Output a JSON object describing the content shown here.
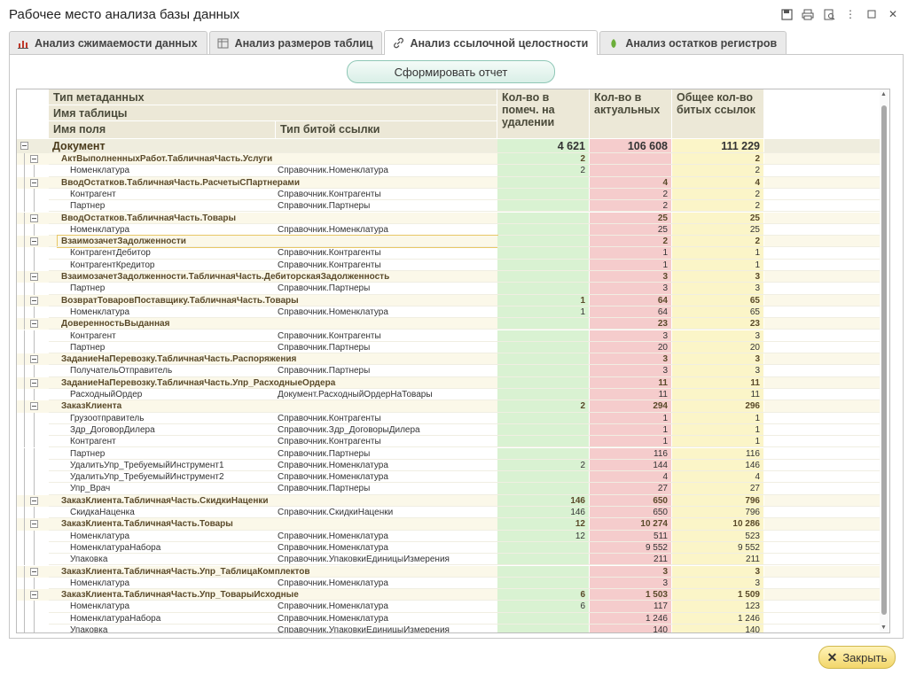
{
  "window": {
    "title": "Рабочее место анализа базы данных",
    "icons": [
      "save-icon",
      "print-icon",
      "preview-icon",
      "more-icon",
      "maximize-icon",
      "close-icon"
    ]
  },
  "tabs": [
    {
      "label": "Анализ сжимаемости данных",
      "icon": "bar-chart-icon",
      "active": false
    },
    {
      "label": "Анализ размеров таблиц",
      "icon": "table-icon",
      "active": false
    },
    {
      "label": "Анализ ссылочной целостности",
      "icon": "link-icon",
      "active": true
    },
    {
      "label": "Анализ остатков регистров",
      "icon": "leaf-icon",
      "active": false
    }
  ],
  "report_button": "Сформировать отчет",
  "close_button": "Закрыть",
  "headers": {
    "meta_type": "Тип метаданных",
    "table_name": "Имя таблицы",
    "field_name": "Имя поля",
    "broken_link_type": "Тип битой ссылки",
    "marked": "Кол-во в помеч. на удалении",
    "actual": "Кол-во в актуальных",
    "total": "Общее кол-во битых ссылок"
  },
  "colors": {
    "marked": "#d9f2d2",
    "actual": "#f5cccc",
    "total": "#fbf5c8",
    "header": "#ece8d7"
  },
  "rows": [
    {
      "level": 0,
      "name": "Документ",
      "type": "",
      "m": "4 621",
      "a": "106 608",
      "t": "111 229"
    },
    {
      "level": 1,
      "name": "АктВыполненныхРабот.ТабличнаяЧасть.Услуги",
      "type": "",
      "m": "2",
      "a": "",
      "t": "2"
    },
    {
      "level": 2,
      "name": "Номенклатура",
      "type": "Справочник.Номенклатура",
      "m": "2",
      "a": "",
      "t": "2"
    },
    {
      "level": 1,
      "name": "ВводОстатков.ТабличнаяЧасть.РасчетыСПартнерами",
      "type": "",
      "m": "",
      "a": "4",
      "t": "4"
    },
    {
      "level": 2,
      "name": "Контрагент",
      "type": "Справочник.Контрагенты",
      "m": "",
      "a": "2",
      "t": "2"
    },
    {
      "level": 2,
      "name": "Партнер",
      "type": "Справочник.Партнеры",
      "m": "",
      "a": "2",
      "t": "2"
    },
    {
      "level": 1,
      "name": "ВводОстатков.ТабличнаяЧасть.Товары",
      "type": "",
      "m": "",
      "a": "25",
      "t": "25"
    },
    {
      "level": 2,
      "name": "Номенклатура",
      "type": "Справочник.Номенклатура",
      "m": "",
      "a": "25",
      "t": "25"
    },
    {
      "level": 1,
      "name": "ВзаимозачетЗадолженности",
      "type": "",
      "m": "",
      "a": "2",
      "t": "2",
      "selected": true
    },
    {
      "level": 2,
      "name": "КонтрагентДебитор",
      "type": "Справочник.Контрагенты",
      "m": "",
      "a": "1",
      "t": "1"
    },
    {
      "level": 2,
      "name": "КонтрагентКредитор",
      "type": "Справочник.Контрагенты",
      "m": "",
      "a": "1",
      "t": "1"
    },
    {
      "level": 1,
      "name": "ВзаимозачетЗадолженности.ТабличнаяЧасть.ДебиторскаяЗадолженность",
      "type": "",
      "m": "",
      "a": "3",
      "t": "3"
    },
    {
      "level": 2,
      "name": "Партнер",
      "type": "Справочник.Партнеры",
      "m": "",
      "a": "3",
      "t": "3"
    },
    {
      "level": 1,
      "name": "ВозвратТоваровПоставщику.ТабличнаяЧасть.Товары",
      "type": "",
      "m": "1",
      "a": "64",
      "t": "65"
    },
    {
      "level": 2,
      "name": "Номенклатура",
      "type": "Справочник.Номенклатура",
      "m": "1",
      "a": "64",
      "t": "65"
    },
    {
      "level": 1,
      "name": "ДоверенностьВыданная",
      "type": "",
      "m": "",
      "a": "23",
      "t": "23"
    },
    {
      "level": 2,
      "name": "Контрагент",
      "type": "Справочник.Контрагенты",
      "m": "",
      "a": "3",
      "t": "3"
    },
    {
      "level": 2,
      "name": "Партнер",
      "type": "Справочник.Партнеры",
      "m": "",
      "a": "20",
      "t": "20"
    },
    {
      "level": 1,
      "name": "ЗаданиеНаПеревозку.ТабличнаяЧасть.Распоряжения",
      "type": "",
      "m": "",
      "a": "3",
      "t": "3"
    },
    {
      "level": 2,
      "name": "ПолучательОтправитель",
      "type": "Справочник.Партнеры",
      "m": "",
      "a": "3",
      "t": "3"
    },
    {
      "level": 1,
      "name": "ЗаданиеНаПеревозку.ТабличнаяЧасть.Упр_РасходныеОрдера",
      "type": "",
      "m": "",
      "a": "11",
      "t": "11"
    },
    {
      "level": 2,
      "name": "РасходныйОрдер",
      "type": "Документ.РасходныйОрдерНаТовары",
      "m": "",
      "a": "11",
      "t": "11"
    },
    {
      "level": 1,
      "name": "ЗаказКлиента",
      "type": "",
      "m": "2",
      "a": "294",
      "t": "296"
    },
    {
      "level": 2,
      "name": "Грузоотправитель",
      "type": "Справочник.Контрагенты",
      "m": "",
      "a": "1",
      "t": "1"
    },
    {
      "level": 2,
      "name": "Здр_ДоговорДилера",
      "type": "Справочник.Здр_ДоговорыДилера",
      "m": "",
      "a": "1",
      "t": "1"
    },
    {
      "level": 2,
      "name": "Контрагент",
      "type": "Справочник.Контрагенты",
      "m": "",
      "a": "1",
      "t": "1"
    },
    {
      "level": 2,
      "name": "Партнер",
      "type": "Справочник.Партнеры",
      "m": "",
      "a": "116",
      "t": "116"
    },
    {
      "level": 2,
      "name": "УдалитьУпр_ТребуемыйИнструмент1",
      "type": "Справочник.Номенклатура",
      "m": "2",
      "a": "144",
      "t": "146"
    },
    {
      "level": 2,
      "name": "УдалитьУпр_ТребуемыйИнструмент2",
      "type": "Справочник.Номенклатура",
      "m": "",
      "a": "4",
      "t": "4"
    },
    {
      "level": 2,
      "name": "Упр_Врач",
      "type": "Справочник.Партнеры",
      "m": "",
      "a": "27",
      "t": "27"
    },
    {
      "level": 1,
      "name": "ЗаказКлиента.ТабличнаяЧасть.СкидкиНаценки",
      "type": "",
      "m": "146",
      "a": "650",
      "t": "796"
    },
    {
      "level": 2,
      "name": "СкидкаНаценка",
      "type": "Справочник.СкидкиНаценки",
      "m": "146",
      "a": "650",
      "t": "796"
    },
    {
      "level": 1,
      "name": "ЗаказКлиента.ТабличнаяЧасть.Товары",
      "type": "",
      "m": "12",
      "a": "10 274",
      "t": "10 286"
    },
    {
      "level": 2,
      "name": "Номенклатура",
      "type": "Справочник.Номенклатура",
      "m": "12",
      "a": "511",
      "t": "523"
    },
    {
      "level": 2,
      "name": "НоменклатураНабора",
      "type": "Справочник.Номенклатура",
      "m": "",
      "a": "9 552",
      "t": "9 552"
    },
    {
      "level": 2,
      "name": "Упаковка",
      "type": "Справочник.УпаковкиЕдиницыИзмерения",
      "m": "",
      "a": "211",
      "t": "211"
    },
    {
      "level": 1,
      "name": "ЗаказКлиента.ТабличнаяЧасть.Упр_ТаблицаКомплектов",
      "type": "",
      "m": "",
      "a": "3",
      "t": "3"
    },
    {
      "level": 2,
      "name": "Номенклатура",
      "type": "Справочник.Номенклатура",
      "m": "",
      "a": "3",
      "t": "3"
    },
    {
      "level": 1,
      "name": "ЗаказКлиента.ТабличнаяЧасть.Упр_ТоварыИсходные",
      "type": "",
      "m": "6",
      "a": "1 503",
      "t": "1 509"
    },
    {
      "level": 2,
      "name": "Номенклатура",
      "type": "Справочник.Номенклатура",
      "m": "6",
      "a": "117",
      "t": "123"
    },
    {
      "level": 2,
      "name": "НоменклатураНабора",
      "type": "Справочник.Номенклатура",
      "m": "",
      "a": "1 246",
      "t": "1 246"
    },
    {
      "level": 2,
      "name": "Упаковка",
      "type": "Справочник.УпаковкиЕдиницыИзмерения",
      "m": "",
      "a": "140",
      "t": "140"
    }
  ]
}
